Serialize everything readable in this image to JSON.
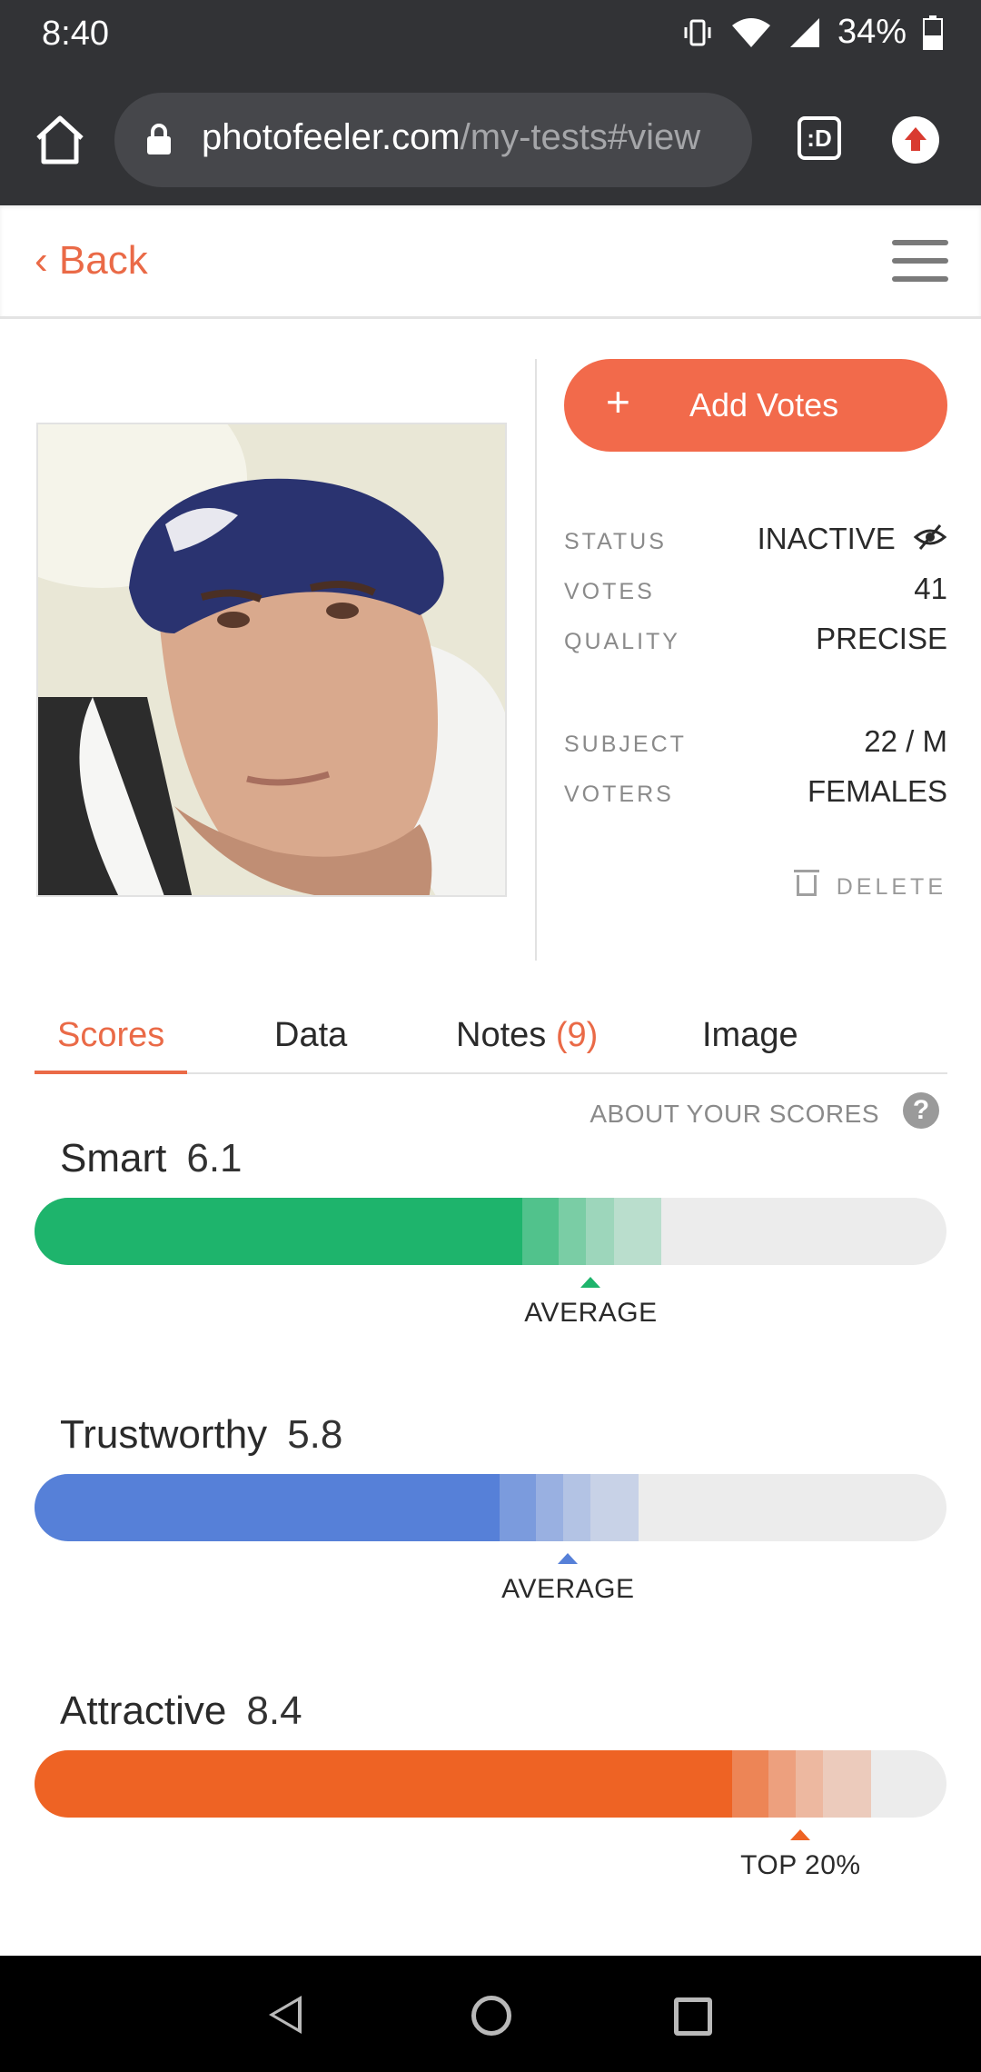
{
  "status_bar": {
    "time": "8:40",
    "battery": "34%"
  },
  "browser": {
    "url_domain": "photofeeler.com",
    "url_path": "/my-tests#view",
    "tab_badge": ":D"
  },
  "header": {
    "back_label": "‹ Back"
  },
  "actions": {
    "add_votes_plus": "+",
    "add_votes_label": "Add Votes",
    "delete_label": "DELETE"
  },
  "info": {
    "rows": [
      {
        "key": "STATUS",
        "value": "INACTIVE"
      },
      {
        "key": "VOTES",
        "value": "41"
      },
      {
        "key": "QUALITY",
        "value": "PRECISE"
      },
      {
        "key": "SUBJECT",
        "value": "22 / M"
      },
      {
        "key": "VOTERS",
        "value": "FEMALES"
      }
    ]
  },
  "tabs": {
    "scores": "Scores",
    "data": "Data",
    "notes": "Notes",
    "notes_count": "(9)",
    "image": "Image"
  },
  "about": {
    "label": "ABOUT YOUR SCORES",
    "help": "?"
  },
  "scores": [
    {
      "name": "Smart",
      "value": "6.1",
      "marker_label": "AVERAGE",
      "marker_fraction": 0.61,
      "color": "#1eb46c"
    },
    {
      "name": "Trustworthy",
      "value": "5.8",
      "marker_label": "AVERAGE",
      "marker_fraction": 0.585,
      "color": "#5680d8"
    },
    {
      "name": "Attractive",
      "value": "8.4",
      "marker_label": "TOP 20%",
      "marker_fraction": 0.84,
      "color": "#ee6324"
    }
  ],
  "colors": {
    "accent": "#ea6a47",
    "button": "#f26a4b",
    "chrome": "#323336"
  }
}
